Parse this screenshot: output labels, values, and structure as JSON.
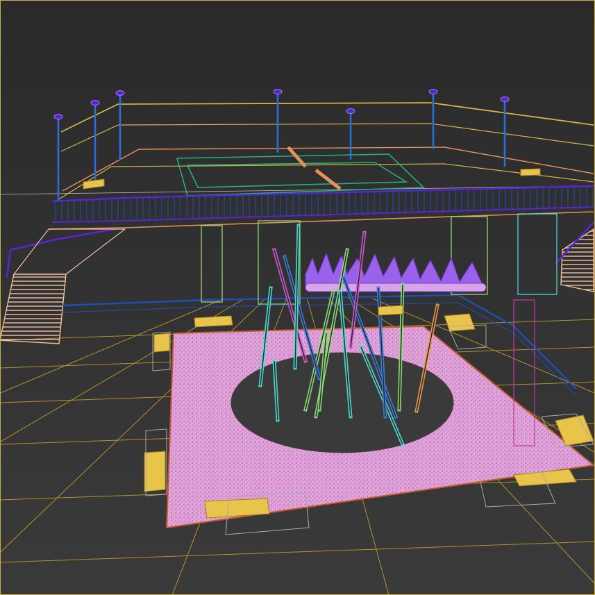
{
  "viewport": {
    "mode": "wireframe",
    "background": "#2d2d2d",
    "frame_color": "#c7b13c"
  },
  "colors": {
    "ground_grid": "#c9a227",
    "ground_grid_light": "#cfcfcf",
    "railing_blue": "#1d4fb8",
    "railing_purple": "#5a23d6",
    "fence_yellow": "#d1b34a",
    "plaza_pink": "#e3a2dc",
    "plaza_speckle": "#4a3a48",
    "bench_yellow": "#e8c44a",
    "stair_peach": "#f2c0a0",
    "court_green": "#22b07a",
    "court_orange": "#e3925a",
    "sculpture_cyan": "#4fe0d6",
    "sculpture_green": "#8ee07a",
    "sculpture_blue": "#3b7ee0",
    "sculpture_orange": "#f09a4a",
    "sculpture_magenta": "#d05ad0",
    "planter_violet": "#9a62ea",
    "lamp_blue": "#2a6ed8"
  },
  "scene_objects": [
    "upper-deck-fence",
    "sports-court",
    "balustrade-railing",
    "left-staircase",
    "right-staircase",
    "plaza-ground",
    "pink-plaza-pad",
    "circular-opening",
    "glass-sculpture",
    "grass-planter",
    "benches",
    "lamp-posts"
  ]
}
